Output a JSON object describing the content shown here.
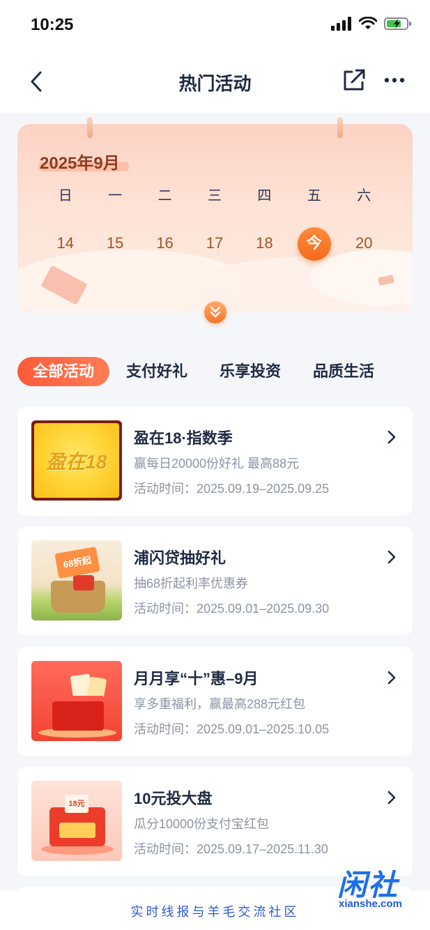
{
  "status_bar": {
    "time": "10:25"
  },
  "navbar": {
    "title": "热门活动"
  },
  "calendar": {
    "month_label": "2025年9月",
    "weekdays": [
      "日",
      "一",
      "二",
      "三",
      "四",
      "五",
      "六"
    ],
    "dates": [
      "14",
      "15",
      "16",
      "17",
      "18",
      "今",
      "20"
    ],
    "today_index": 5
  },
  "tabs": [
    {
      "label": "全部活动",
      "active": true
    },
    {
      "label": "支付好礼",
      "active": false
    },
    {
      "label": "乐享投资",
      "active": false
    },
    {
      "label": "品质生活",
      "active": false
    }
  ],
  "activities": [
    {
      "title": "盈在18·指数季",
      "desc": "赢每日20000份好礼 最高88元",
      "time": "活动时间：2025.09.19–2025.09.25",
      "thumb_text": "盈在18"
    },
    {
      "title": "浦闪贷抽好礼",
      "desc": "抽68折起利率优惠券",
      "time": "活动时间：2025.09.01–2025.09.30",
      "thumb_text": "68折起"
    },
    {
      "title": "月月享“十”惠–9月",
      "desc": "享多重福利，赢最高288元红包",
      "time": "活动时间：2025.09.01–2025.10.05"
    },
    {
      "title": "10元投大盘",
      "desc": "瓜分10000份支付宝红包",
      "time": "活动时间：2025.09.17–2025.11.30",
      "thumb_text": "18元"
    }
  ],
  "footer": {
    "text": "实时线报与羊毛交流社区"
  },
  "watermark": {
    "main": "闲社",
    "sub": "xianshe.com"
  },
  "colors": {
    "accent": "#ff5a3a",
    "today": "#f56a1c",
    "footer_link": "#2b5bd1"
  }
}
